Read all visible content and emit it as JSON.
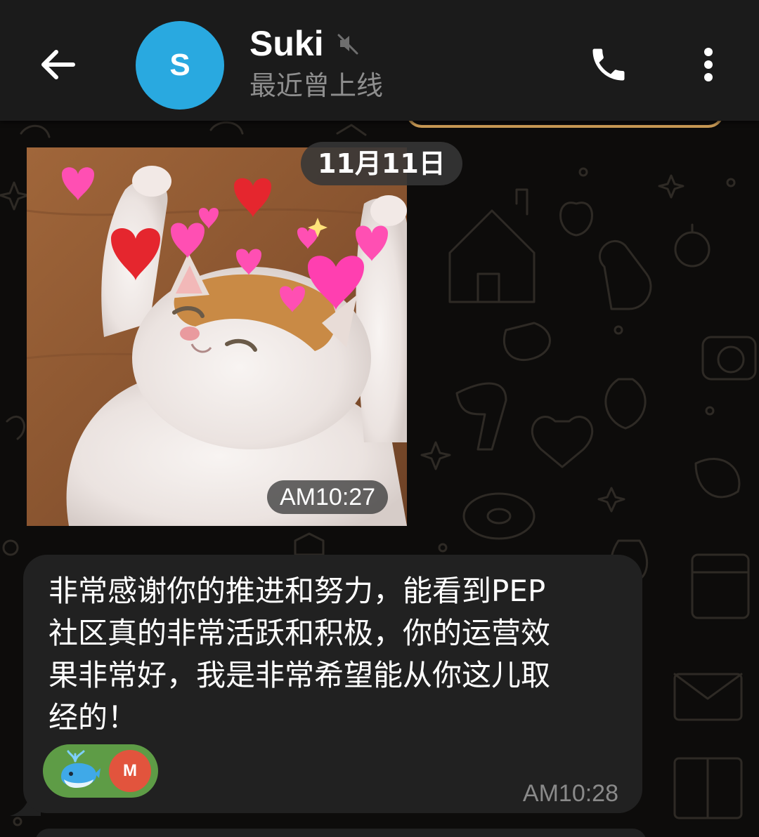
{
  "header": {
    "back_icon": "arrow-left-icon",
    "avatar_initial": "S",
    "avatar_color": "#29a9e0",
    "contact_name": "Suki",
    "muted_icon": "muted-speaker-icon",
    "status": "最近曾上线",
    "call_icon": "phone-icon",
    "menu_icon": "more-vertical-icon"
  },
  "chat": {
    "date_chip": "11月11日",
    "photo_message": {
      "description_icon": "cat-with-hearts-sticker",
      "time": "AM10:27"
    },
    "text_message": {
      "lines": [
        "非常感谢你的推进和努力，能看到PEP",
        "社区真的非常活跃和积极，你的运营效",
        "果非常好，我是非常希望能从你这儿取",
        "经的！"
      ],
      "reaction": {
        "emoji_icon": "whale-emoji",
        "reactor_initial": "M",
        "reactor_color": "#e2543d",
        "pill_color": "#5e9c46"
      },
      "time": "AM10:28"
    }
  },
  "colors": {
    "background": "#0d0c0b",
    "bubble": "#212121",
    "accent_pinned": "#c99a55"
  }
}
